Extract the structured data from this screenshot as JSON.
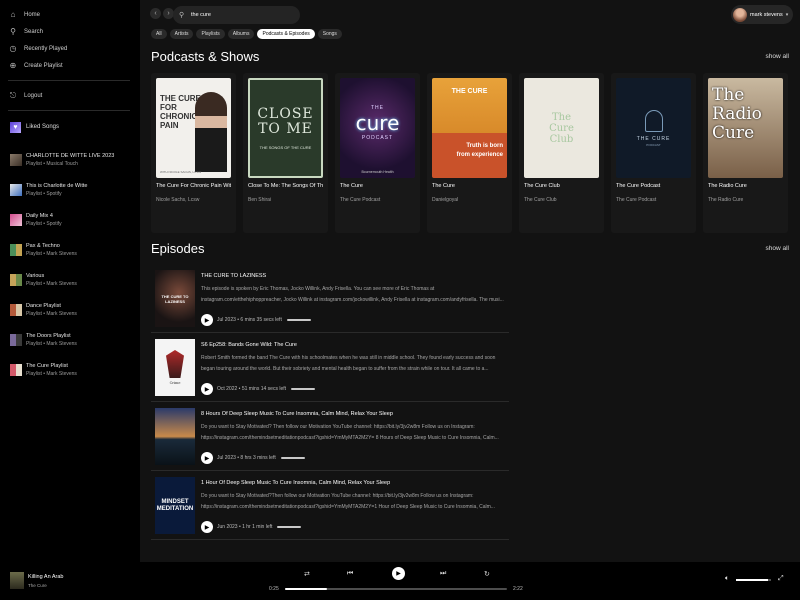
{
  "sidebar": {
    "nav": [
      {
        "label": "Home",
        "icon": "home-icon"
      },
      {
        "label": "Search",
        "icon": "search-icon"
      },
      {
        "label": "Recently Played",
        "icon": "clock-icon"
      },
      {
        "label": "Create Playlist",
        "icon": "plus-icon"
      }
    ],
    "logout": "Logout",
    "liked": "Liked Songs",
    "playlists": [
      {
        "title": "CHARLOTTE DE WITTE LIVE 2023",
        "subtitle": "Playlist • Musical Touch",
        "color": "#8a7a6a"
      },
      {
        "title": "This is Charlotte de Witte",
        "subtitle": "Playlist • Spotify",
        "color": "#3d6fbf"
      },
      {
        "title": "Daily Mix 4",
        "subtitle": "Playlist • Spotify",
        "color": "#d24b8c"
      },
      {
        "title": "Pax & Techno",
        "subtitle": "Playlist • Mark Stevens",
        "color": "#4b8f5a"
      },
      {
        "title": "Various",
        "subtitle": "Playlist • Mark Stevens",
        "color": "#c6a45a"
      },
      {
        "title": "Dance Playlist",
        "subtitle": "Playlist • Mark Stevens",
        "color": "#b45a3a"
      },
      {
        "title": "The Doors Playlist",
        "subtitle": "Playlist • Mark Stevens",
        "color": "#7a6a9a"
      },
      {
        "title": "The Cure Playlist",
        "subtitle": "Playlist • Mark Stevens",
        "color": "#d45a6a"
      }
    ]
  },
  "topbar": {
    "back": "‹",
    "forward": "›",
    "search_value": "the cure",
    "user_name": "mark stevens"
  },
  "filters": [
    "All",
    "Artists",
    "Playlists",
    "Albums",
    "Podcasts & Episodes",
    "Songs"
  ],
  "podcasts": {
    "title": "Podcasts & Shows",
    "show_all": "show all",
    "items": [
      {
        "title": "The Cure For Chronic Pain With ...",
        "subtitle": "Nicole Sachs, Lcsw"
      },
      {
        "title": "Close To Me: The Songs Of The ...",
        "subtitle": "Ben Shirai"
      },
      {
        "title": "The Cure",
        "subtitle": "The Cure Podcast"
      },
      {
        "title": "The Cure",
        "subtitle": "Danielgoyal"
      },
      {
        "title": "The Cure Club",
        "subtitle": "The Cure Club"
      },
      {
        "title": "The Cure Podcast",
        "subtitle": "The Cure Podcast"
      },
      {
        "title": "The Radio Cure",
        "subtitle": "The Radio Cure"
      }
    ],
    "art_text": {
      "a1_line1": "THE CURE",
      "a1_line2": "FOR",
      "a1_line3": "CHRONIC",
      "a1_line4": "PAIN",
      "a1_foot": "WITH NICOLE SACHS, LCSW",
      "a2_main": "CLOSE TO ME",
      "a2_sub": "THE SONGS OF THE CURE",
      "a3_the": "THE",
      "a3_cure": "cure",
      "a3_pod": "PODCAST",
      "a3_foot": "Bournemouth Health",
      "a4_title": "THE CURE",
      "a4_l1": "Truth is born",
      "a4_l2": "from experience",
      "a5_l1": "The",
      "a5_l2": "Cure",
      "a5_l3": "Club",
      "a6_title": "THE CURE",
      "a6_sub": "PODCAST",
      "a7_l1": "The",
      "a7_l2": "Radio",
      "a7_l3": "Cure"
    }
  },
  "episodes": {
    "title": "Episodes",
    "show_all": "show all",
    "items": [
      {
        "title": "THE CURE TO LAZINESS",
        "description": "This episode is spoken by Eric Thomas, Jocko Willink, Andy Frisella. You can see more of Eric Thomas at instagram.com/etthehiphoppreacher, Jocko Willink at instagram.com/jockowillink, Andy Frisella at instagram.com/andyfrisella. The musi...",
        "meta": "Jul 2023 • 6 mins 35 secs left",
        "art_text": "THE CURE TO LAZINESS"
      },
      {
        "title": "S6 Ep258: Bands Gone Wild: The Cure",
        "description": "Robert Smith formed the band The Cure with his schoolmates when he was still in middle school. They found early success and soon began touring around the world. But their sobriety and mental health began to suffer from the strain while on tour. It all came to a...",
        "meta": "Oct 2022 • 51 mins 14 secs left",
        "art_text": "Crime"
      },
      {
        "title": "8 Hours Of Deep Sleep Music To Cure Insomnia, Calm Mind, Relax Your Sleep",
        "description": "Do you want to Stay Motivated? Then follow our Motivation YouTube channel: https://bit.ly/3jv2w8m Follow us on Instagram: https://instagram.com/themindsetmeditationpodcast?igshid=YmMyMTA2M2Y= 8 Hours of Deep Sleep Music to Cure Insomnia, Calm...",
        "meta": "Jul 2023 • 8 hrs 3 mins left",
        "art_text": ""
      },
      {
        "title": "1 Hour Of Deep Sleep Music To Cure Insomnia, Calm Mind, Relax Your Sleep",
        "description": "Do you want to Stay Motivated?Then follow our Motivation YouTube channel: https://bit.ly/3jv2w8m Follow us on Instagram: https://instagram.com/themindsetmeditationpodcast?igshid=YmMyMTA2M2Y=1 Hour of Deep Sleep Music to Cure Insomnia, Calm...",
        "meta": "Jun 2023 • 1 hr 1 min left",
        "art_text": "MINDSET MEDITATION"
      }
    ]
  },
  "player": {
    "track": "Killing An Arab",
    "artist": "The Cure",
    "elapsed": "0:25",
    "duration": "2:22",
    "progress": 0.19,
    "volume": 0.9
  }
}
